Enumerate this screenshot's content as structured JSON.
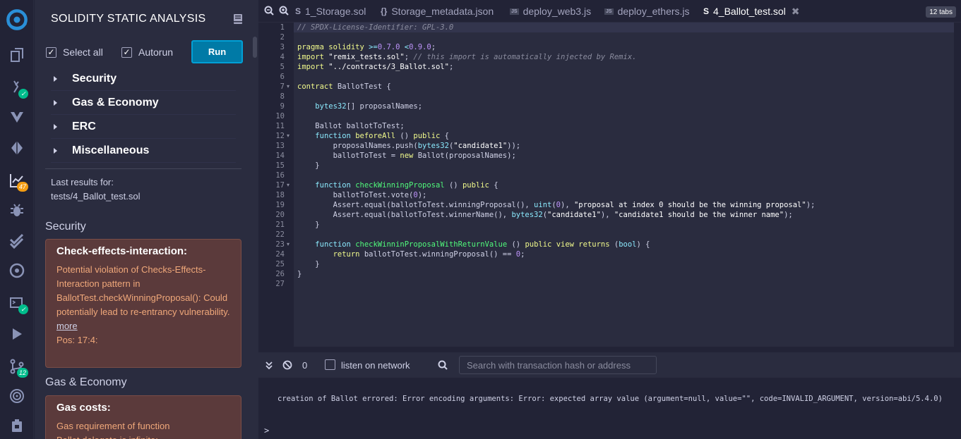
{
  "sidebar": {
    "title": "SOLIDITY STATIC ANALYSIS",
    "select_all_label": "Select all",
    "autorun_label": "Autorun",
    "run_label": "Run",
    "categories": [
      "Security",
      "Gas & Economy",
      "ERC",
      "Miscellaneous"
    ],
    "last_results_label": "Last results for:",
    "last_results_file": "tests/4_Ballot_test.sol",
    "security_heading": "Security",
    "security_warning": {
      "title": "Check-effects-interaction:",
      "description": "Potential violation of Checks-Effects-Interaction pattern in BallotTest.checkWinningProposal(): Could potentially lead to re-entrancy vulnerability.",
      "more_label": "more",
      "pos": "Pos: 17:4:"
    },
    "gas_heading": "Gas & Economy",
    "gas_warning": {
      "title": "Gas costs:",
      "description": "Gas requirement of function Ballot.delegate is infinite:"
    }
  },
  "icons": {
    "badge_analysis": "47",
    "badge_git": "12"
  },
  "tabs": {
    "items": [
      {
        "label": "1_Storage.sol",
        "icon": "S"
      },
      {
        "label": "Storage_metadata.json",
        "icon": "{}"
      },
      {
        "label": "deploy_web3.js",
        "icon": "JS"
      },
      {
        "label": "deploy_ethers.js",
        "icon": "JS"
      },
      {
        "label": "4_Ballot_test.sol",
        "icon": "S"
      }
    ],
    "count_label": "12 tabs"
  },
  "editor": {
    "line_numbers": [
      "1",
      "2",
      "3",
      "4",
      "5",
      "6",
      "7",
      "8",
      "9",
      "10",
      "11",
      "12",
      "13",
      "14",
      "15",
      "16",
      "17",
      "18",
      "19",
      "20",
      "21",
      "22",
      "23",
      "24",
      "25",
      "26",
      "27"
    ]
  },
  "terminal": {
    "count": "0",
    "listen_label": "listen on network",
    "search_placeholder": "Search with transaction hash or address",
    "message": "creation of Ballot errored: Error encoding arguments: Error: expected array value (argument=null, value=\"\", code=INVALID_ARGUMENT, version=abi/5.4.0)",
    "prompt": ">"
  },
  "colors": {
    "accent": "#007aa6",
    "warning_bg": "#5b3a3b",
    "badge_success": "#00bc8c",
    "badge_warning": "#f39c12"
  }
}
